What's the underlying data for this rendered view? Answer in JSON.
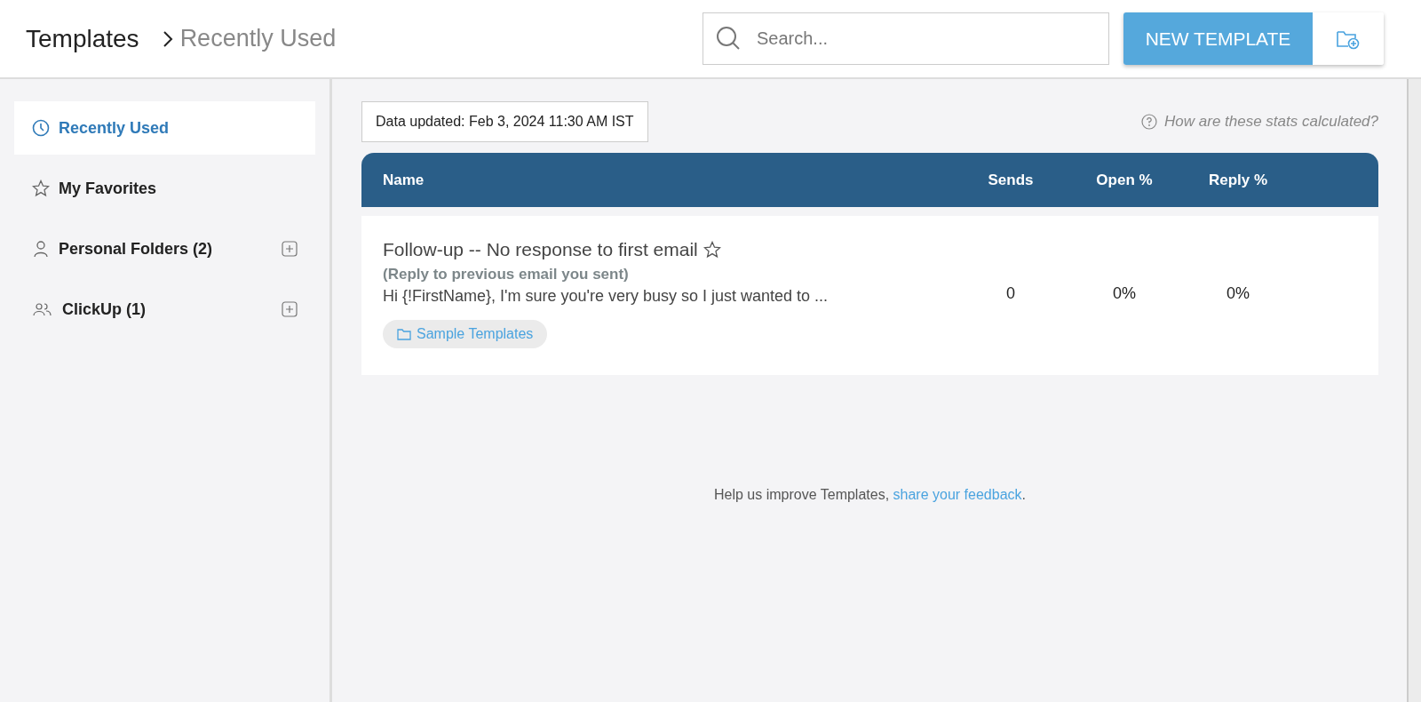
{
  "header": {
    "title": "Templates",
    "breadcrumb": "Recently Used",
    "search": {
      "placeholder": "Search..."
    },
    "new_button": "NEW TEMPLATE"
  },
  "sidebar": {
    "items": [
      {
        "kind": "clock",
        "label": "Recently Used",
        "selected": true,
        "add": false
      },
      {
        "kind": "star",
        "label": "My Favorites",
        "selected": false,
        "add": false
      },
      {
        "kind": "person",
        "label": "Personal Folders (2)",
        "selected": false,
        "add": true
      },
      {
        "kind": "group",
        "label": "ClickUp (1)",
        "selected": false,
        "add": true
      }
    ]
  },
  "data_updated": "Data updated: Feb 3, 2024 11:30 AM IST",
  "stats_help": "How are these stats calculated?",
  "table": {
    "columns": [
      "Name",
      "Sends",
      "Open %",
      "Reply %"
    ],
    "rows": [
      {
        "title": "Follow-up -- No response to first email",
        "favorite": false,
        "subtitle": "(Reply to previous email you sent)",
        "preview": "Hi {!FirstName}, I'm sure you're very busy so I just wanted to ...",
        "folder": "Sample Templates",
        "sends": "0",
        "open": "0%",
        "reply": "0%"
      }
    ]
  },
  "feedback": {
    "text": "Help us improve Templates,",
    "link": "share your feedback",
    "suffix": "."
  }
}
